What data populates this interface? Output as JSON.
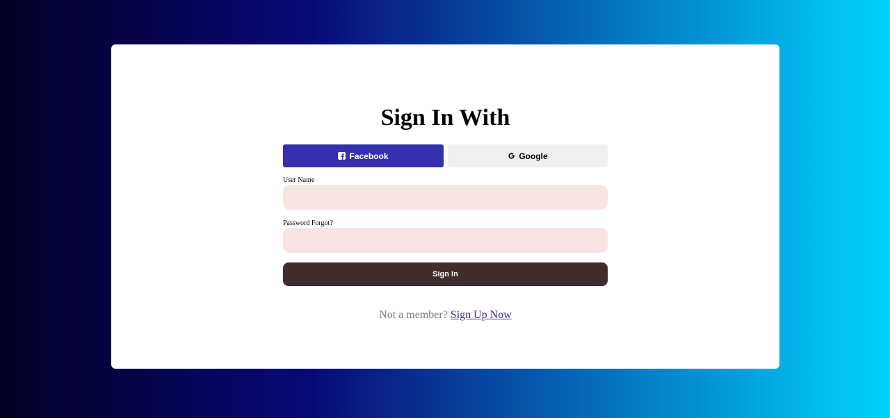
{
  "page": {
    "background_colors": [
      "#020024",
      "#090979",
      "#00d4ff"
    ]
  },
  "login": {
    "title": "Sign In With",
    "social": {
      "facebook_label": "Facebook",
      "facebook_icon": "facebook-square-icon",
      "facebook_color": "#3430b0",
      "google_label": "Google",
      "google_icon": "google-g-icon",
      "google_color": "#efefef"
    },
    "username": {
      "label": "User Name",
      "value": "",
      "placeholder": ""
    },
    "password": {
      "label": "Password Forgot?",
      "value": "",
      "placeholder": ""
    },
    "submit_label": "Sign In",
    "submit_color": "#422d2d",
    "input_color": "#f9e4e4",
    "footer": {
      "prompt": "Not a member?",
      "link": "Sign Up Now"
    }
  }
}
